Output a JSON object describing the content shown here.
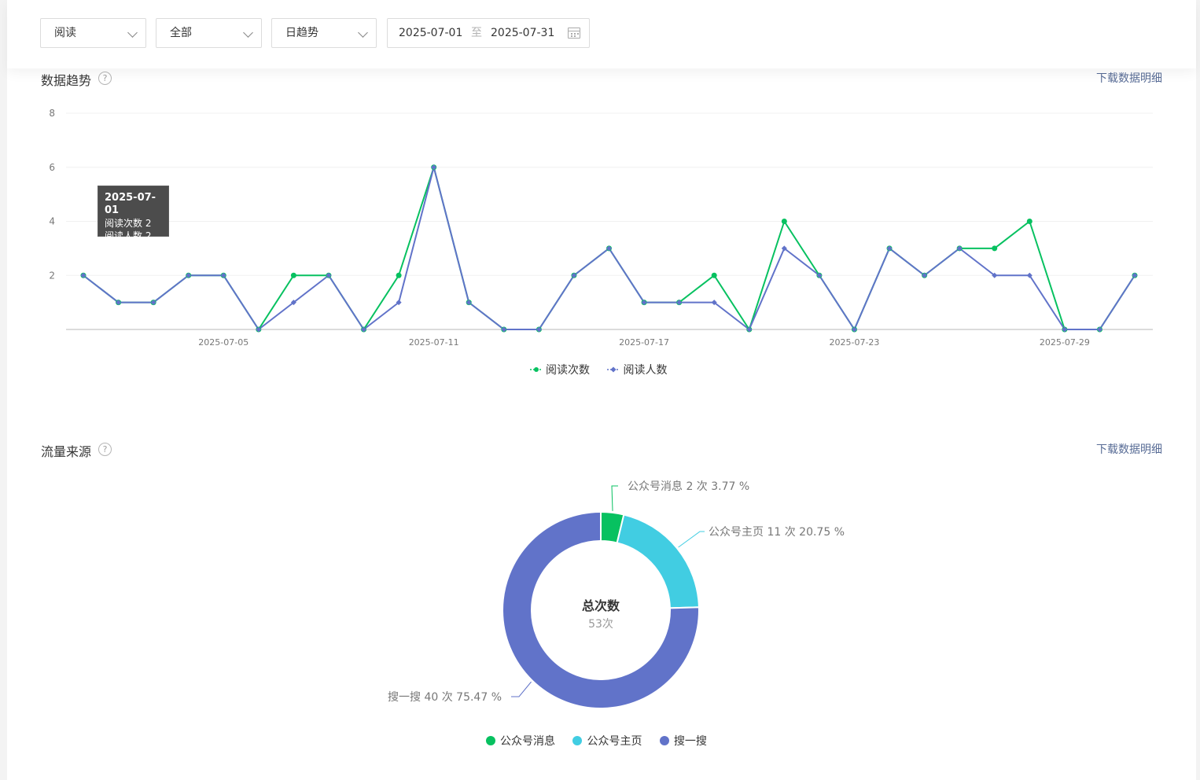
{
  "filters": {
    "metric": "阅读",
    "scope": "全部",
    "granularity": "日趋势",
    "date_start": "2025-07-01",
    "date_sep": "至",
    "date_end": "2025-07-31"
  },
  "trend": {
    "title": "数据趋势",
    "help": "?",
    "download": "下载数据明细",
    "tooltip": {
      "date": "2025-07-01",
      "line1": "阅读次数 2",
      "line2": "阅读人数 2"
    }
  },
  "source": {
    "title": "流量来源",
    "help": "?",
    "download": "下载数据明细",
    "center_label": "总次数",
    "center_value": "53次"
  },
  "colors": {
    "green": "#07c160",
    "blue": "#6173c9",
    "cyan": "#41cde2",
    "link": "#576b95"
  },
  "chart_data": [
    {
      "type": "line",
      "title": "",
      "x": [
        "2025-07-01",
        "2025-07-02",
        "2025-07-03",
        "2025-07-04",
        "2025-07-05",
        "2025-07-06",
        "2025-07-07",
        "2025-07-08",
        "2025-07-09",
        "2025-07-10",
        "2025-07-11",
        "2025-07-12",
        "2025-07-13",
        "2025-07-14",
        "2025-07-15",
        "2025-07-16",
        "2025-07-17",
        "2025-07-18",
        "2025-07-19",
        "2025-07-20",
        "2025-07-21",
        "2025-07-22",
        "2025-07-23",
        "2025-07-24",
        "2025-07-25",
        "2025-07-26",
        "2025-07-27",
        "2025-07-28",
        "2025-07-29",
        "2025-07-30",
        "2025-07-31"
      ],
      "x_ticks": [
        "2025-07-05",
        "2025-07-11",
        "2025-07-17",
        "2025-07-23",
        "2025-07-29"
      ],
      "y_ticks": [
        "2",
        "4",
        "6",
        "8"
      ],
      "ylim": [
        0,
        8
      ],
      "grid": true,
      "legend": "bottom-center",
      "series": [
        {
          "name": "阅读次数",
          "color": "#07c160",
          "values": [
            2,
            1,
            1,
            2,
            2,
            0,
            2,
            2,
            0,
            2,
            6,
            1,
            0,
            0,
            2,
            3,
            1,
            1,
            2,
            0,
            4,
            2,
            0,
            3,
            2,
            3,
            3,
            4,
            0,
            0,
            2
          ]
        },
        {
          "name": "阅读人数",
          "color": "#6173c9",
          "values": [
            2,
            1,
            1,
            2,
            2,
            0,
            1,
            2,
            0,
            1,
            6,
            1,
            0,
            0,
            2,
            3,
            1,
            1,
            1,
            0,
            3,
            2,
            0,
            3,
            2,
            3,
            2,
            2,
            0,
            0,
            2
          ]
        }
      ]
    },
    {
      "type": "pie",
      "title": "",
      "legend": "bottom-center",
      "slices": [
        {
          "name": "公众号消息",
          "value": 2,
          "percent": 3.77,
          "label": "公众号消息 2 次 3.77 %",
          "color": "#07c160"
        },
        {
          "name": "公众号主页",
          "value": 11,
          "percent": 20.75,
          "label": "公众号主页 11 次 20.75 %",
          "color": "#41cde2"
        },
        {
          "name": "搜一搜",
          "value": 40,
          "percent": 75.47,
          "label": "搜一搜 40 次 75.47 %",
          "color": "#6173c9"
        }
      ]
    }
  ]
}
